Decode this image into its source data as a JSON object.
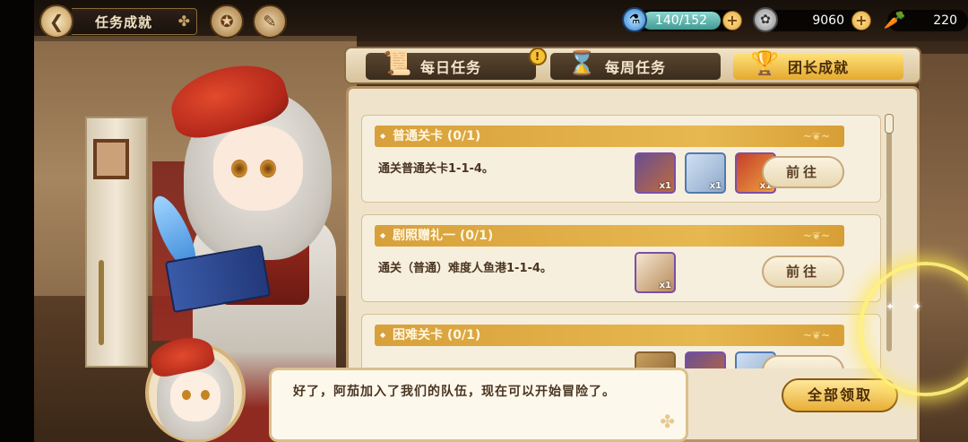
{
  "header": {
    "title": "任务成就",
    "energy": "140/152",
    "coins": "9060",
    "carrots": "220"
  },
  "tabs": [
    {
      "label": "每日任务",
      "badge": "!"
    },
    {
      "label": "每周任务"
    },
    {
      "label": "团长成就",
      "active": true
    }
  ],
  "quests": [
    {
      "title": "普通关卡 (0/1)",
      "desc": "通关普通关卡1-1-4。",
      "rewards": [
        "x1",
        "x1",
        "x1"
      ],
      "button": "前往"
    },
    {
      "title": "剧照赠礼一 (0/1)",
      "desc": "通关（普通）难度人鱼港1-1-4。",
      "rewards": [
        "x1"
      ],
      "button": "前往"
    },
    {
      "title": "困难关卡 (0/1)",
      "desc": "",
      "rewards": [
        "",
        "",
        ""
      ],
      "button": ""
    }
  ],
  "claim_all": "全部领取",
  "dialog": {
    "text": "好了，阿茄加入了我们的队伍，现在可以开始冒险了。"
  },
  "colors": {
    "accent_gold": "#e4a92e",
    "panel_bg": "#efe4cb",
    "quest_header": "#d8a03a",
    "text_brown": "#4a3522"
  },
  "icons": {
    "back": "back-arrow-icon",
    "energy": "potion-icon",
    "coin": "coin-icon",
    "carrot": "carrot-icon"
  }
}
